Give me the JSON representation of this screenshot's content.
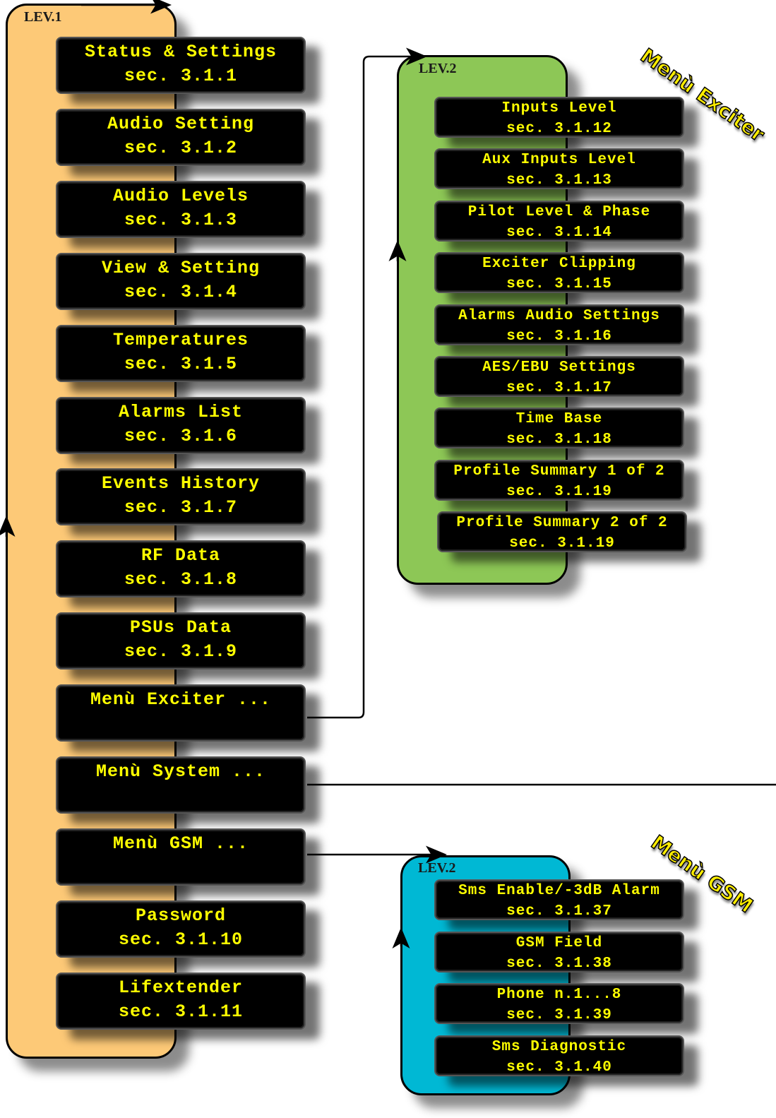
{
  "level1": {
    "label": "LEV.1",
    "color": "#FDC977",
    "items": [
      {
        "title": "Status & Settings",
        "sec": "sec. 3.1.1"
      },
      {
        "title": "Audio Setting",
        "sec": "sec. 3.1.2"
      },
      {
        "title": "Audio Levels",
        "sec": "sec. 3.1.3"
      },
      {
        "title": "View & Setting",
        "sec": "sec. 3.1.4"
      },
      {
        "title": "Temperatures",
        "sec": "sec. 3.1.5"
      },
      {
        "title": "Alarms List",
        "sec": "sec. 3.1.6"
      },
      {
        "title": "Events History",
        "sec": "sec. 3.1.7"
      },
      {
        "title": "RF Data",
        "sec": "sec. 3.1.8"
      },
      {
        "title": "PSUs Data",
        "sec": "sec. 3.1.9"
      },
      {
        "title": "Menù Exciter ...",
        "sec": ""
      },
      {
        "title": "Menù System ...",
        "sec": ""
      },
      {
        "title": "Menù GSM ...",
        "sec": ""
      },
      {
        "title": "Password",
        "sec": "sec. 3.1.10"
      },
      {
        "title": "Lifextender",
        "sec": "sec. 3.1.11"
      }
    ]
  },
  "exciter": {
    "label": "LEV.2",
    "tag": "Menù Exciter",
    "color": "#8DC756",
    "items": [
      {
        "title": "Inputs Level",
        "sec": "sec. 3.1.12"
      },
      {
        "title": "Aux Inputs Level",
        "sec": "sec. 3.1.13"
      },
      {
        "title": "Pilot Level & Phase",
        "sec": "sec. 3.1.14"
      },
      {
        "title": "Exciter Clipping",
        "sec": "sec. 3.1.15"
      },
      {
        "title": "Alarms Audio Settings",
        "sec": "sec. 3.1.16"
      },
      {
        "title": "AES/EBU Settings",
        "sec": "sec. 3.1.17"
      },
      {
        "title": "Time Base",
        "sec": "sec. 3.1.18"
      },
      {
        "title": "Profile Summary 1 of 2",
        "sec": "sec. 3.1.19"
      },
      {
        "title": "Profile Summary 2 of 2",
        "sec": "sec. 3.1.19"
      }
    ]
  },
  "gsm": {
    "label": "LEV.2",
    "tag": "Menù GSM",
    "color": "#00B8D4",
    "items": [
      {
        "title": "Sms Enable/-3dB Alarm",
        "sec": "sec. 3.1.37"
      },
      {
        "title": "GSM Field",
        "sec": "sec. 3.1.38"
      },
      {
        "title": "Phone n.1...8",
        "sec": "sec. 3.1.39"
      },
      {
        "title": "Sms Diagnostic",
        "sec": "sec. 3.1.40"
      }
    ]
  }
}
